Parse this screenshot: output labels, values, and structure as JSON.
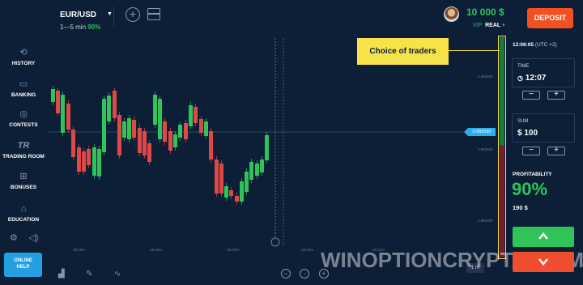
{
  "header": {
    "asset_name": "EUR/USD",
    "asset_timeframe": "1—5 min",
    "asset_payout": "90%",
    "balance": "10 000 $",
    "account_level": "VIP",
    "account_type": "REAL",
    "deposit_label": "DEPOSIT"
  },
  "sidebar": {
    "items": [
      {
        "label": "HISTORY",
        "icon": "history-icon"
      },
      {
        "label": "BANKING",
        "icon": "wallet-icon"
      },
      {
        "label": "CONTESTS",
        "icon": "trophy-icon"
      },
      {
        "label": "TRADING ROOM",
        "icon": "trading-room-icon"
      },
      {
        "label": "BONUSES",
        "icon": "gift-icon"
      },
      {
        "label": "EDUCATION",
        "icon": "graduation-cap-icon"
      }
    ],
    "help_line1": "ONLINE",
    "help_line2": "HELP"
  },
  "chart": {
    "current_price": "0.882550",
    "price_ticks": [
      "0.882600",
      "0.882550",
      "0.882500",
      "0.882400"
    ],
    "time_ticks": [
      "18:19m",
      "18:19m",
      "18:20m",
      "18:20m",
      "18:21m"
    ],
    "callout": "Choice of traders",
    "timeframe": "1 m",
    "up_color": "#2fc35a",
    "down_color": "#e04848"
  },
  "panel": {
    "clock": "12:06:05",
    "timezone": "(UTC +2)",
    "time_label": "TIME",
    "time_value": "12:07",
    "sum_label": "SUM",
    "sum_value": "$ 100",
    "minus": "−",
    "plus": "+",
    "profitability_label": "PROFITABILITY",
    "profitability_value": "90%",
    "profit_amount": "190 $"
  },
  "watermark": "WINOPTIONCRYPTO.COM"
}
